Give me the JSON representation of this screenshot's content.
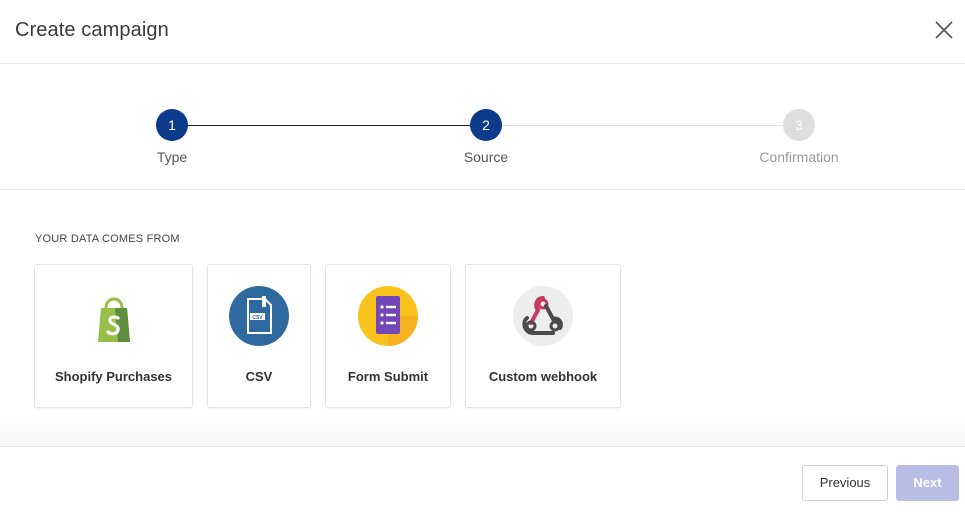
{
  "modal": {
    "title": "Create campaign",
    "close_icon": "close-icon"
  },
  "stepper": {
    "active_color": "#0d3b8c",
    "inactive_color": "#dedede",
    "steps": [
      {
        "number": "1",
        "label": "Type",
        "state": "complete"
      },
      {
        "number": "2",
        "label": "Source",
        "state": "active"
      },
      {
        "number": "3",
        "label": "Confirmation",
        "state": "inactive"
      }
    ]
  },
  "content": {
    "section_label": "YOUR DATA COMES FROM",
    "sources": [
      {
        "label": "Shopify Purchases",
        "icon": "shopify-icon"
      },
      {
        "label": "CSV",
        "icon": "csv-icon"
      },
      {
        "label": "Form Submit",
        "icon": "google-forms-icon"
      },
      {
        "label": "Custom webhook",
        "icon": "webhook-icon"
      }
    ]
  },
  "footer": {
    "previous_label": "Previous",
    "next_label": "Next",
    "next_color": "#b9bde6"
  }
}
